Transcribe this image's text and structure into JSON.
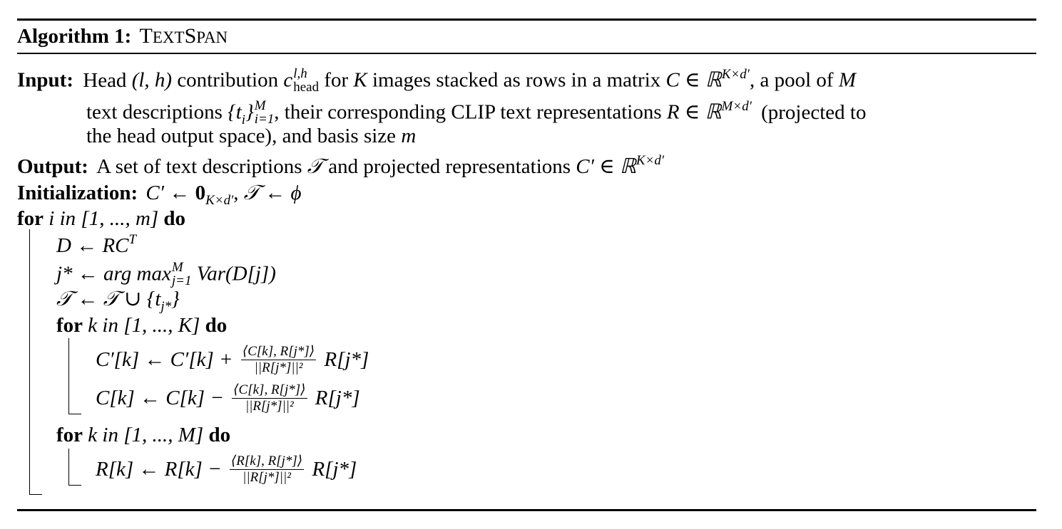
{
  "algorithm": {
    "label": "Algorithm 1:",
    "name_first": "T",
    "name_rest_1": "EXT",
    "name_S": "S",
    "name_rest_2": "PAN"
  },
  "input": {
    "label": "Input:",
    "line1": [
      "Head",
      "(l, h)",
      "contribution",
      "c",
      "l,h",
      "head",
      "for",
      "K",
      "images stacked as rows in a matrix",
      "C ∈ ℝ",
      "K×d′",
      ", a pool of",
      "M"
    ],
    "line2": [
      "text descriptions",
      "{t",
      "i",
      "}",
      "M",
      "i=1",
      ", their corresponding CLIP text representations",
      "R ∈ ℝ",
      "M×d′",
      "(projected to"
    ],
    "line3": [
      "the head output space), and basis size",
      "m"
    ]
  },
  "output": {
    "label": "Output:",
    "text1": "A set of text descriptions",
    "T": "𝒯",
    "text2": "and projected representations",
    "expr": "C′ ∈ ℝ",
    "sup": "K×d′"
  },
  "init": {
    "label": "Initialization:",
    "expr1": "C′ ← ",
    "zero": "0",
    "zero_sub": "K×d′",
    "expr2": ", 𝒯 ← ϕ"
  },
  "loop_i": {
    "for": "for",
    "var": "i in",
    "range": "[1, ..., m]",
    "do": "do"
  },
  "steps": {
    "s1": "D ← RC",
    "s1_sup": "T",
    "s2a": "j* ← arg max",
    "s2_sup": "M",
    "s2_sub": "j=1",
    "s2b": "Var(D[j])",
    "s3": "𝒯 ← 𝒯 ∪ {t",
    "s3_sub": "j*",
    "s3_end": "}"
  },
  "loop_k1": {
    "for": "for",
    "var": "k in",
    "range": "[1, ..., K]",
    "do": "do",
    "c1_left": "C′[k] ← C′[k] +",
    "c1_num": "⟨C[k], R[j*]⟩",
    "c1_den": "||R[j*]||²",
    "c1_right": "R[j*]",
    "c2_left": "C[k] ← C[k] −",
    "c2_num": "⟨C[k], R[j*]⟩",
    "c2_den": "||R[j*]||²",
    "c2_right": "R[j*]"
  },
  "loop_k2": {
    "for": "for",
    "var": "k in",
    "range": "[1, ..., M]",
    "do": "do",
    "r_left": "R[k] ← R[k] −",
    "r_num": "⟨R[k], R[j*]⟩",
    "r_den": "||R[j*]||²",
    "r_right": "R[j*]"
  }
}
